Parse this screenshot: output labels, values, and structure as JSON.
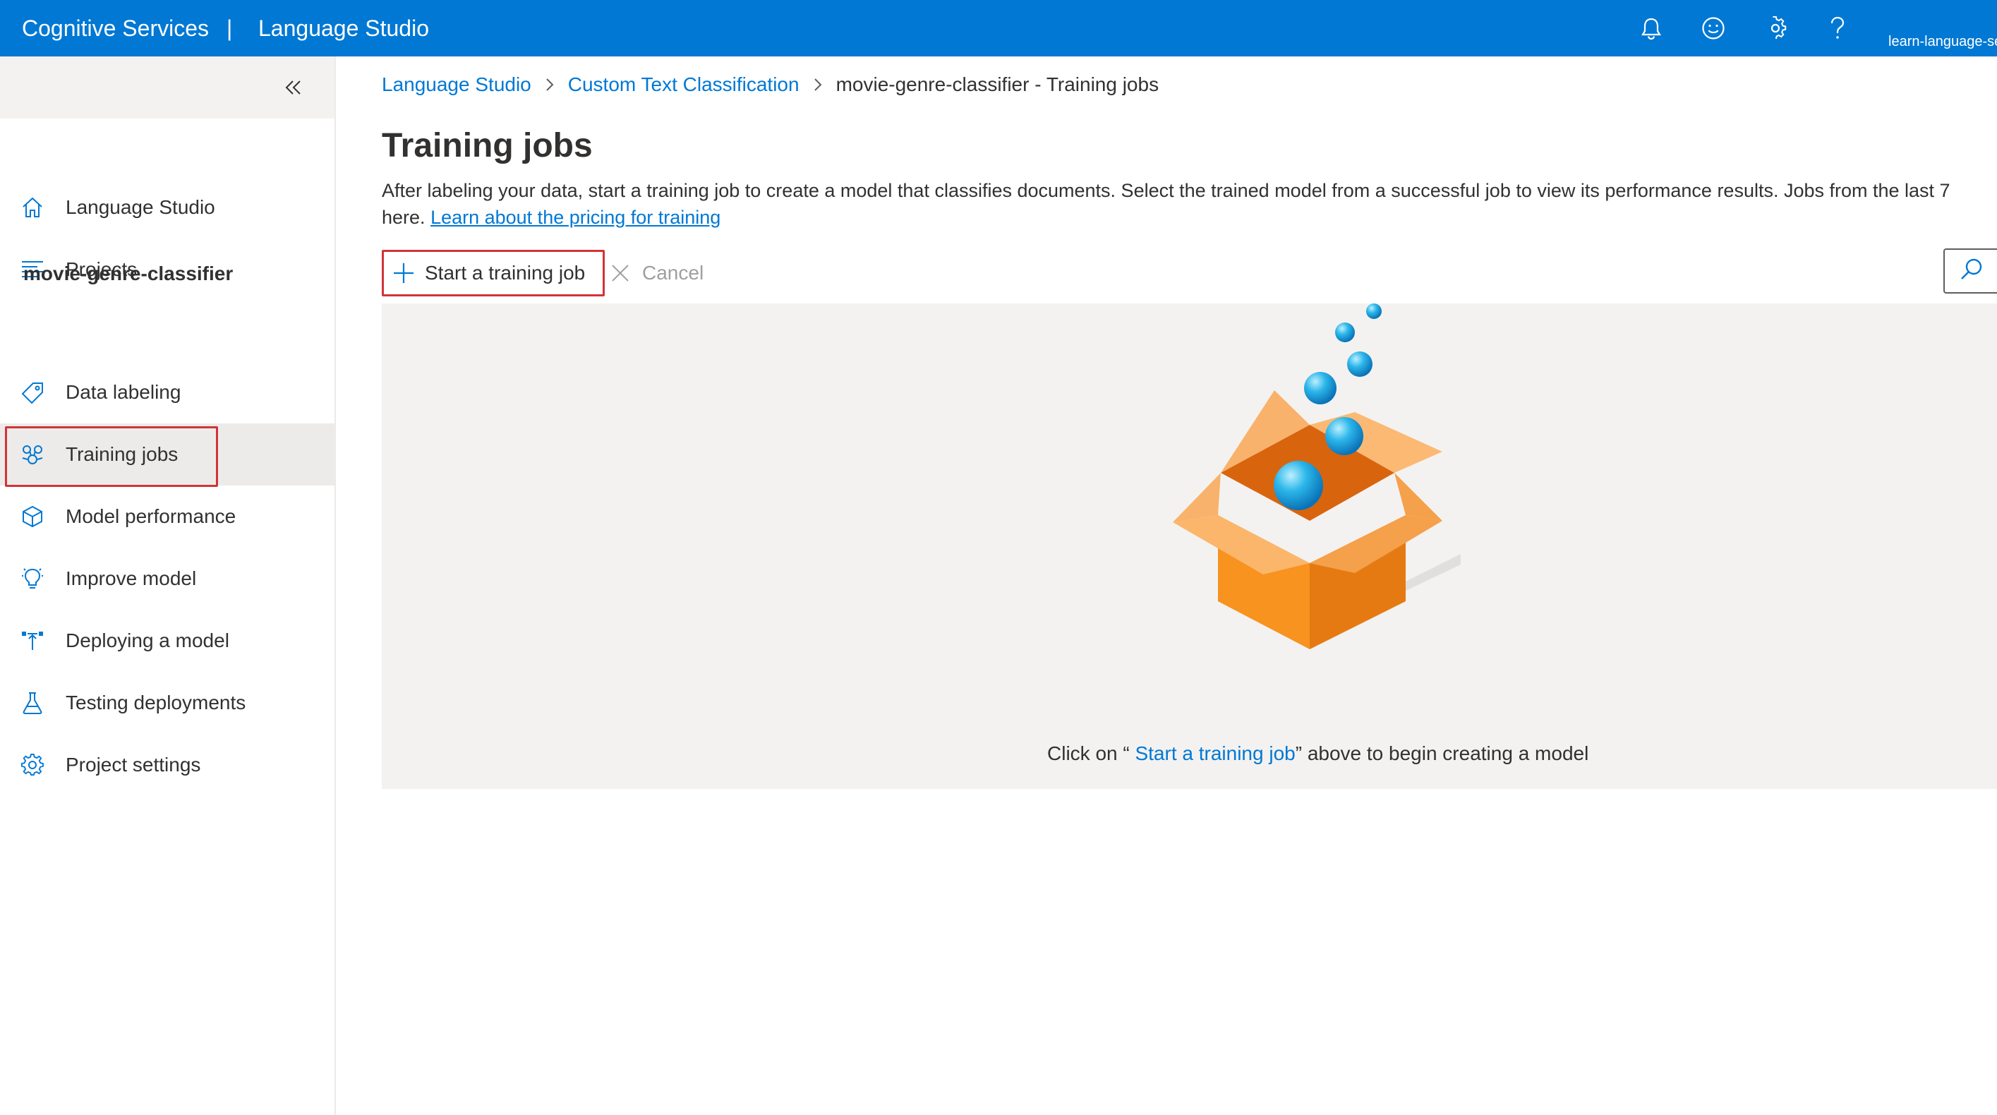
{
  "topbar": {
    "brand": "Cognitive Services",
    "separator": "|",
    "product": "Language Studio",
    "icons": [
      "bell-icon",
      "smiley-icon",
      "gear-icon",
      "help-icon"
    ],
    "account": "learn-language-se"
  },
  "sidebar": {
    "collapse_icon": "double-chevron-left-icon",
    "items_top": [
      {
        "label": "Language Studio",
        "icon": "home-icon"
      },
      {
        "label": "Projects",
        "icon": "list-icon"
      }
    ],
    "project_name": "movie-genre-classifier",
    "items_project": [
      {
        "label": "Data labeling",
        "icon": "tag-icon"
      },
      {
        "label": "Training jobs",
        "icon": "brain-icon",
        "selected": true
      },
      {
        "label": "Model performance",
        "icon": "cube-icon"
      },
      {
        "label": "Improve model",
        "icon": "lightbulb-icon"
      },
      {
        "label": "Deploying a model",
        "icon": "deploy-icon"
      },
      {
        "label": "Testing deployments",
        "icon": "flask-icon"
      },
      {
        "label": "Project settings",
        "icon": "gear-icon"
      }
    ]
  },
  "breadcrumb": {
    "items": [
      "Language Studio",
      "Custom Text Classification"
    ],
    "current": "movie-genre-classifier - Training jobs"
  },
  "page": {
    "title": "Training jobs",
    "description_line1": "After labeling your data, start a training job to create a model that classifies documents. Select the trained model from a successful job to view its performance results. Jobs from the last 7",
    "description_line2_prefix": "here.",
    "description_link": "Learn about the pricing for training"
  },
  "toolbar": {
    "start_label": "Start a training job",
    "cancel_label": "Cancel",
    "search_icon": "search-icon"
  },
  "empty_state": {
    "illustration": "open-box-with-bubbles",
    "prefix": "Click on “ ",
    "link": "Start a training job",
    "suffix": "” above to begin creating a model"
  },
  "colors": {
    "brand_blue": "#0078d4",
    "highlight_red": "#d13438",
    "box_orange": "#f7931e",
    "bubble_blue": "#1ea7e1"
  }
}
